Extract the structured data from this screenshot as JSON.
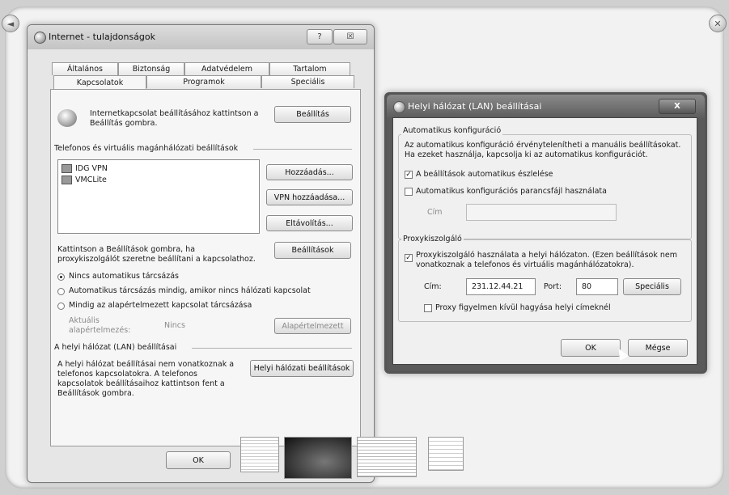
{
  "main_window": {
    "title": "Internet - tulajdonságok",
    "help_btn": "?",
    "close_btn": "☒",
    "tabs_row1": [
      "Általános",
      "Biztonság",
      "Adatvédelem",
      "Tartalom"
    ],
    "tabs_row2": [
      "Kapcsolatok",
      "Programok",
      "Speciális"
    ],
    "setup_text": "Internetkapcsolat beállításához kattintson a Beállítás gombra.",
    "setup_btn": "Beállítás",
    "vpn_group": "Telefonos és virtuális magánhálózati beállítások",
    "vpn_list": [
      "IDG VPN",
      "VMCLite"
    ],
    "add_btn": "Hozzáadás...",
    "add_vpn_btn": "VPN hozzáadása...",
    "remove_btn": "Eltávolítás...",
    "proxy_text": "Kattintson a Beállítások gombra, ha proxykiszolgálót szeretne beállítani a kapcsolathoz.",
    "settings_btn": "Beállítások",
    "radio1": "Nincs automatikus tárcsázás",
    "radio2": "Automatikus tárcsázás mindig, amikor nincs hálózati kapcsolat",
    "radio3": "Mindig az alapértelmezett kapcsolat tárcsázása",
    "current_label": "Aktuális alapértelmezés:",
    "current_value": "Nincs",
    "default_btn": "Alapértelmezett",
    "lan_group": "A helyi hálózat (LAN) beállításai",
    "lan_text": "A helyi hálózat beállításai nem vonatkoznak a telefonos kapcsolatokra. A telefonos kapcsolatok beállításaihoz kattintson fent a Beállítások gombra.",
    "lan_btn": "Helyi hálózati beállítások",
    "ok_btn": "OK"
  },
  "lan_dialog": {
    "title": "Helyi hálózat (LAN) beállításai",
    "close_btn": "X",
    "auto_group": "Automatikus konfiguráció",
    "auto_text": "Az automatikus konfiguráció érvénytelenítheti a manuális beállításokat. Ha ezeket használja, kapcsolja ki az automatikus konfigurációt.",
    "auto_detect": "A beállítások automatikus észlelése",
    "auto_script": "Automatikus konfigurációs parancsfájl használata",
    "addr_label": "Cím",
    "proxy_group": "Proxykiszolgáló",
    "proxy_use": "Proxykiszolgáló használata a helyi hálózaton. (Ezen beállítások nem vonatkoznak a telefonos és virtuális magánhálózatokra).",
    "proxy_addr_label": "Cím:",
    "proxy_addr": "231.12.44.21",
    "port_label": "Port:",
    "port": "80",
    "advanced_btn": "Speciális",
    "bypass": "Proxy figyelmen kívül hagyása helyi címeknél",
    "ok_btn": "OK",
    "cancel_btn": "Mégse"
  },
  "corner": {
    "left_icon": "◄",
    "right_icon": "✕"
  }
}
